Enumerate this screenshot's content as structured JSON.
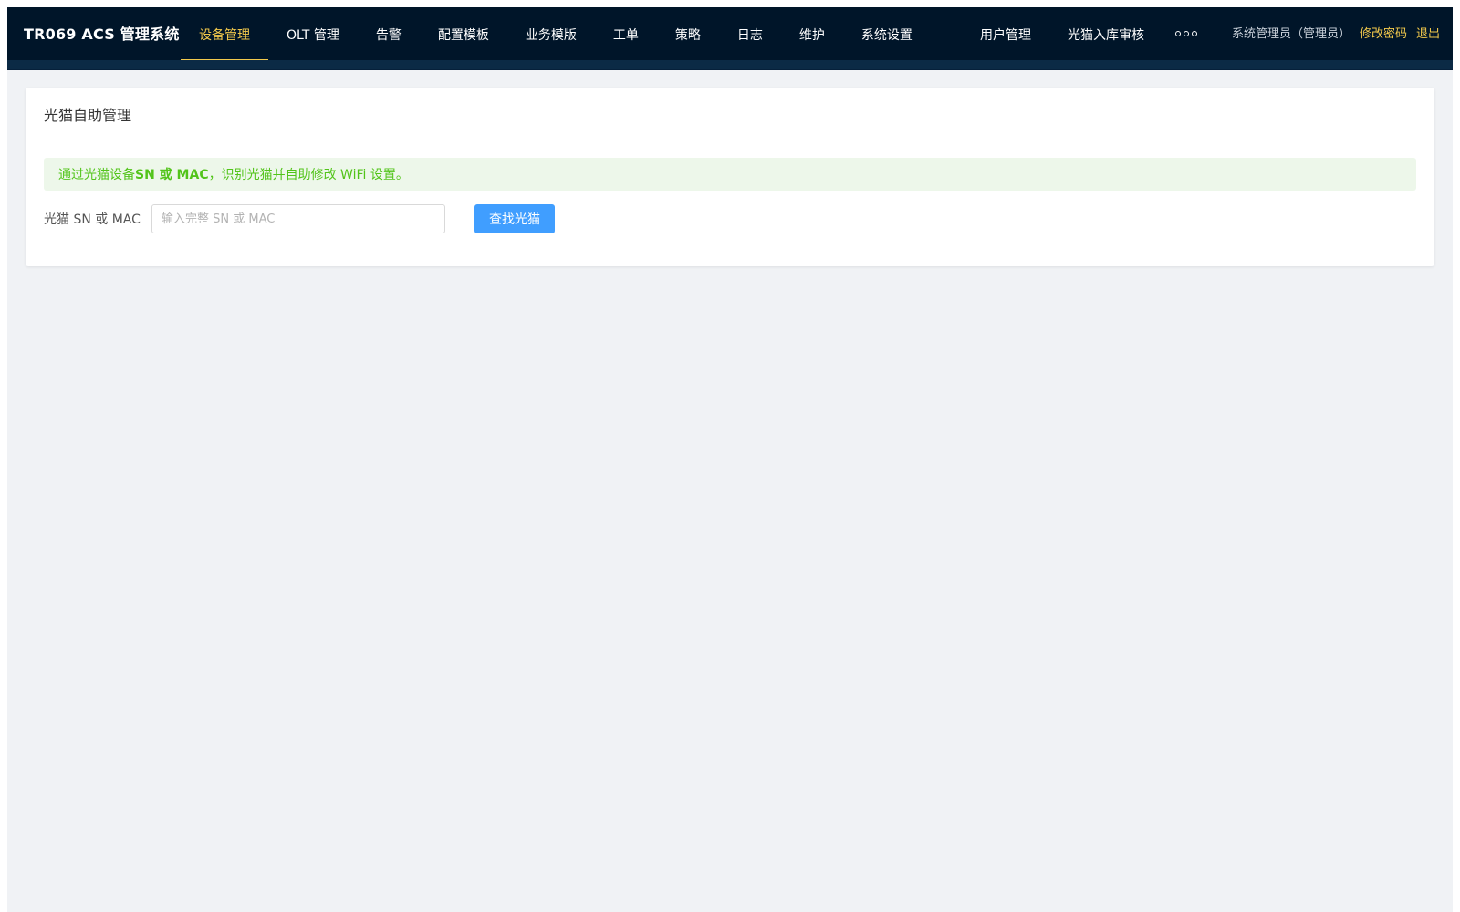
{
  "header": {
    "brand": "TR069 ACS 管理系统",
    "menu": [
      {
        "label": "设备管理",
        "active": true
      },
      {
        "label": "OLT 管理",
        "active": false
      },
      {
        "label": "告警",
        "active": false
      },
      {
        "label": "配置模板",
        "active": false
      },
      {
        "label": "业务模版",
        "active": false
      },
      {
        "label": "工单",
        "active": false
      },
      {
        "label": "策略",
        "active": false
      },
      {
        "label": "日志",
        "active": false
      },
      {
        "label": "维护",
        "active": false
      },
      {
        "label": "系统设置",
        "active": false
      }
    ],
    "menu_secondary": [
      {
        "label": "用户管理"
      },
      {
        "label": "光猫入库审核"
      }
    ],
    "more_icon": "ellipsis-icon",
    "user": "系统管理员（管理员）",
    "change_password": "修改密码",
    "logout": "退出",
    "colors": {
      "bar": "#001529",
      "active": "#f2c94c"
    }
  },
  "card": {
    "title": "光猫自助管理",
    "alert": {
      "prefix": "通过光猫设备 ",
      "strong": "SN 或 MAC",
      "suffix": "，识别光猫并自助修改 WiFi 设置。",
      "color": "#52c41a"
    },
    "form": {
      "label": "光猫 SN 或 MAC",
      "placeholder": "输入完整 SN 或 MAC",
      "value": "",
      "button": "查找光猫",
      "button_color": "#409eff"
    }
  }
}
